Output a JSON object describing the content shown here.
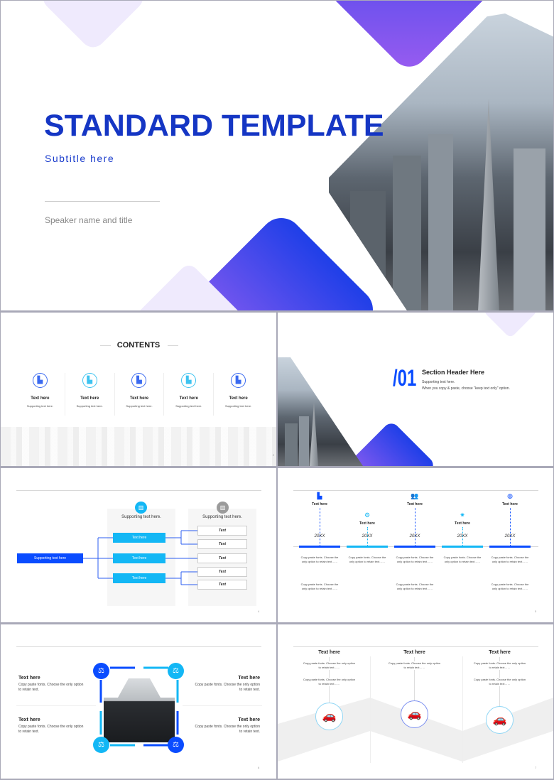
{
  "colors": {
    "primary": "#1f3fd6",
    "accent": "#0a5cff",
    "cyan": "#13b7f5",
    "purple": "#8a5cf0",
    "grey": "#9b9b9b"
  },
  "slide1": {
    "title": "STANDARD TEMPLATE",
    "subtitle": "Subtitle here",
    "speaker": "Speaker name and title"
  },
  "slide2": {
    "title": "CONTENTS",
    "page": "2",
    "items": [
      {
        "icon": "building-icon",
        "title": "Text here",
        "text": "Supporting text here."
      },
      {
        "icon": "building-icon",
        "title": "Text here",
        "text": "Supporting text here."
      },
      {
        "icon": "building-icon",
        "title": "Text here",
        "text": "Supporting text here."
      },
      {
        "icon": "building-icon",
        "title": "Text here",
        "text": "Supporting text here."
      },
      {
        "icon": "building-icon",
        "title": "Text here",
        "text": "Supporting text here."
      }
    ]
  },
  "slide3": {
    "number": "/01",
    "header": "Section Header Here",
    "line1": "Supporting text here.",
    "line2": "When you copy & paste, choose \"keep text only\" option."
  },
  "slide4": {
    "page": "4",
    "root": "Supporting text here",
    "col1_label": "Supporting text here.",
    "col2_label": "Supporting text here.",
    "mid": [
      "Text here",
      "Text here",
      "Text here"
    ],
    "leaves": [
      "Text",
      "Text",
      "Text",
      "Text",
      "Text"
    ]
  },
  "slide5": {
    "page": "5",
    "items": [
      {
        "title": "Text here",
        "year": "20XX",
        "icon": "buildings-icon",
        "text1": "Copy paste fonts. Choose the only option to retain text……",
        "text2": "Copy paste fonts. Choose the only option to retain text……"
      },
      {
        "title": "Text here",
        "year": "20XX",
        "icon": "gear-icon",
        "text1": "Copy paste fonts. Choose the only option to retain text……",
        "text2": ""
      },
      {
        "title": "Text here",
        "year": "20XX",
        "icon": "users-icon",
        "text1": "Copy paste fonts. Choose the only option to retain text……",
        "text2": "Copy paste fonts. Choose the only option to retain text……"
      },
      {
        "title": "Text here",
        "year": "20XX",
        "icon": "sun-icon",
        "text1": "Copy paste fonts. Choose the only option to retain text……",
        "text2": ""
      },
      {
        "title": "Text here",
        "year": "20XX",
        "icon": "globe-icon",
        "text1": "Copy paste fonts. Choose the only option to retain text……",
        "text2": "Copy paste fonts. Choose the only option to retain text……"
      }
    ]
  },
  "slide6": {
    "page": "6",
    "blocks": [
      {
        "title": "Text here",
        "text": "Copy paste fonts. Choose the only option to retain text."
      },
      {
        "title": "Text here",
        "text": "Copy paste fonts. Choose the only option to retain text."
      },
      {
        "title": "Text here",
        "text": "Copy paste fonts. Choose the only option to retain text."
      },
      {
        "title": "Text here",
        "text": "Copy paste fonts. Choose the only option to retain text."
      }
    ],
    "icon": "scales-icon"
  },
  "slide7": {
    "page": "7",
    "cols": [
      {
        "title": "Text here",
        "text1": "Copy paste fonts. Choose the only option to retain text……",
        "text2": "Copy paste fonts. Choose the only option to retain text……",
        "icon": "eco-car-icon"
      },
      {
        "title": "Text here",
        "text1": "Copy paste fonts. Choose the only option to retain text……",
        "text2": "",
        "icon": "eco-car-icon"
      },
      {
        "title": "Text here",
        "text1": "Copy paste fonts. Choose the only option to retain text……",
        "text2": "Copy paste fonts. Choose the only option to retain text……",
        "icon": "eco-car-icon"
      }
    ]
  }
}
